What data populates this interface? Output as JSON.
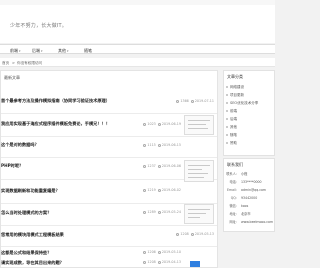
{
  "header": {
    "slogan": "少年不努力，长大做IT。"
  },
  "nav": {
    "items": [
      {
        "label": "前端",
        "has_caret": true
      },
      {
        "label": "后端",
        "has_caret": true
      },
      {
        "label": "其他",
        "has_caret": true
      },
      {
        "label": "随笔",
        "has_caret": false
      }
    ],
    "caret": "▾"
  },
  "breadcrumb": {
    "home": "首页",
    "sep": ">",
    "current": "你没有权限访问"
  },
  "main": {
    "title": "最新文章",
    "posts": [
      {
        "title": "首个最参考方法及操作模拟指南（协同学习验证技术原理）",
        "views": "1366",
        "date": "2019-07-11",
        "has_thumb": false
      },
      {
        "title": "我应用实现基于海应式程序插件模板免费论，手模兄！！！",
        "views": "1023",
        "date": "2019-06-19",
        "has_thumb": true
      },
      {
        "title": "这个是对的数据吗？",
        "views": "1115",
        "date": "2019-06-15",
        "has_thumb": false
      },
      {
        "title": "PHP时呢？",
        "views": "1237",
        "date": "2019-06-06",
        "has_thumb": false
      },
      {
        "title": "实现数据刷新和功能重复编是？",
        "views": "1219",
        "date": "2019-06-02",
        "has_thumb": true
      },
      {
        "title": "怎么当时处理模式的方案？",
        "views": "1289",
        "date": "2019-05-24",
        "has_thumb": true
      },
      {
        "title": "您常用的模块用模式工程模板结果",
        "views": "1208",
        "date": "2019-05-13",
        "has_thumb": false
      },
      {
        "title": "这都是公式和结果保持些？",
        "views": "1206",
        "date": "2019-05-10",
        "has_thumb": false
      },
      {
        "title": "请实现成数，导在其目出来的题？",
        "views": "1208",
        "date": "2019-04-13",
        "has_thumb": false
      }
    ]
  },
  "sidebar": {
    "categories": {
      "title": "文章分类",
      "items": [
        "网络建设",
        "项目更新",
        "SEO优化技术分享",
        "前端",
        "后端",
        "其他",
        "随笔",
        "赞助"
      ]
    },
    "contact": {
      "title": "联系我们",
      "rows": [
        {
          "k": "联系人：",
          "v": "小程"
        },
        {
          "k": "电话：",
          "v": "133****0000"
        },
        {
          "k": "Email：",
          "v": "admin@qq.com"
        },
        {
          "k": "QQ：",
          "v": "93442000"
        },
        {
          "k": "微信：",
          "v": "koos"
        },
        {
          "k": "地址：",
          "v": "北京市"
        },
        {
          "k": "网址：",
          "v": "www.beelmooo.com"
        }
      ]
    }
  },
  "colors": {
    "accent": "#2f7fe0",
    "title": "#222222",
    "meta": "#999999"
  }
}
